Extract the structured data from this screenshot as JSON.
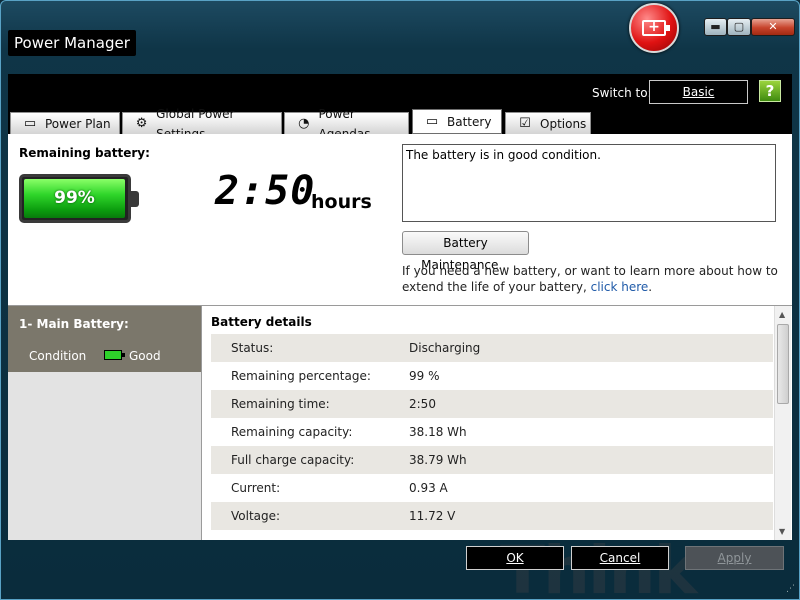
{
  "window": {
    "title": "Power Manager",
    "controls": {
      "minimize": "▬",
      "maximize": "▢",
      "close": "✕"
    }
  },
  "header": {
    "switch_to_label": "Switch to:",
    "basic_button": "Basic",
    "help_icon": "?"
  },
  "tabs": [
    {
      "label": "Power Plan",
      "icon": "document-icon",
      "glyph": "▭"
    },
    {
      "label": "Global Power Settings",
      "icon": "gear-icon",
      "glyph": "⚙"
    },
    {
      "label": "Power Agendas",
      "icon": "calendar-clock-icon",
      "glyph": "◔"
    },
    {
      "label": "Battery",
      "icon": "battery-icon",
      "glyph": "▭"
    },
    {
      "label": "Options",
      "icon": "checkbox-icon",
      "glyph": "☑"
    }
  ],
  "active_tab": "Battery",
  "battery_summary": {
    "remaining_label": "Remaining battery:",
    "percentage_text": "99%",
    "percentage": 99,
    "time": "2:50",
    "time_unit": "hours",
    "status_message": "The battery is in good condition.",
    "maintenance_button": "Battery Maintenance...",
    "info_text": "If you need a new battery, or want to learn more about how to extend the life of your battery,",
    "info_link": "click here",
    "info_suffix": "."
  },
  "battery_list": {
    "main_battery_label": "1- Main Battery:",
    "condition_label": "Condition",
    "condition_value": "Good"
  },
  "details": {
    "title": "Battery details",
    "rows": [
      {
        "key": "Status:",
        "value": "Discharging"
      },
      {
        "key": "Remaining percentage:",
        "value": "99 %"
      },
      {
        "key": "Remaining time:",
        "value": "2:50"
      },
      {
        "key": "Remaining capacity:",
        "value": "38.18 Wh"
      },
      {
        "key": "Full charge capacity:",
        "value": "38.79 Wh"
      },
      {
        "key": "Current:",
        "value": "0.93 A"
      },
      {
        "key": "Voltage:",
        "value": "11.72 V"
      }
    ]
  },
  "footer": {
    "ok": "OK",
    "cancel": "Cancel",
    "apply": "Apply"
  },
  "watermark": "Think",
  "colors": {
    "frame": "#0a2c3c",
    "header_band": "#000000",
    "battery_green": "#2fd52a",
    "left_panel": "#7b776b",
    "link": "#1f5aa8",
    "close_red": "#c7432b"
  }
}
